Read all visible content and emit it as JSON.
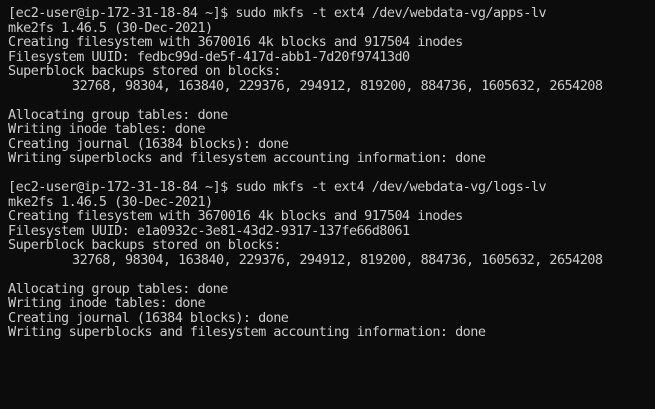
{
  "terminal": {
    "block1": {
      "command_line": "[ec2-user@ip-172-31-18-84 ~]$ sudo mkfs -t ext4 /dev/webdata-vg/apps-lv",
      "version": "mke2fs 1.46.5 (30-Dec-2021)",
      "creating": "Creating filesystem with 3670016 4k blocks and 917504 inodes",
      "uuid": "Filesystem UUID: fedbc99d-de5f-417d-abb1-7d20f97413d0",
      "superblock_header": "Superblock backups stored on blocks:",
      "superblock_list": "32768, 98304, 163840, 229376, 294912, 819200, 884736, 1605632, 2654208",
      "alloc": "Allocating group tables: done",
      "inode": "Writing inode tables: done",
      "journal": "Creating journal (16384 blocks): done",
      "superblocks": "Writing superblocks and filesystem accounting information: done"
    },
    "block2": {
      "command_line": "[ec2-user@ip-172-31-18-84 ~]$ sudo mkfs -t ext4 /dev/webdata-vg/logs-lv",
      "version": "mke2fs 1.46.5 (30-Dec-2021)",
      "creating": "Creating filesystem with 3670016 4k blocks and 917504 inodes",
      "uuid": "Filesystem UUID: e1a0932c-3e81-43d2-9317-137fe66d8061",
      "superblock_header": "Superblock backups stored on blocks:",
      "superblock_list": "32768, 98304, 163840, 229376, 294912, 819200, 884736, 1605632, 2654208",
      "alloc": "Allocating group tables: done",
      "inode": "Writing inode tables: done",
      "journal": "Creating journal (16384 blocks): done",
      "superblocks": "Writing superblocks and filesystem accounting information: done"
    }
  }
}
